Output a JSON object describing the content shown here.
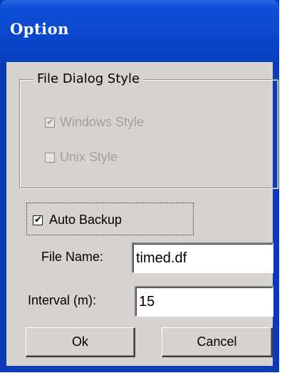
{
  "dialog": {
    "title": "Option",
    "file_dialog_style": {
      "label": "File Dialog Style",
      "options": [
        {
          "label": "Windows Style",
          "checked": true,
          "enabled": false
        },
        {
          "label": "Unix Style",
          "checked": false,
          "enabled": false
        }
      ]
    },
    "auto_backup": {
      "label": "Auto Backup",
      "checked": true
    },
    "file_name": {
      "label": "File Name:",
      "value": "timed.df"
    },
    "interval": {
      "label": "Interval (m):",
      "value": "15"
    },
    "buttons": {
      "ok": "Ok",
      "cancel": "Cancel"
    }
  }
}
